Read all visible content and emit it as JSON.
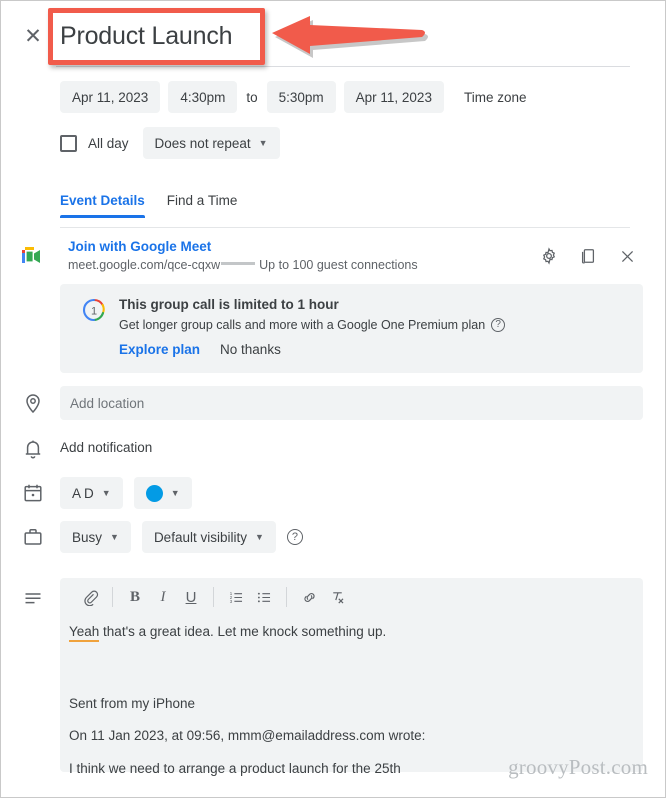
{
  "window": {
    "close_label": "✕"
  },
  "event": {
    "title": "Product Launch",
    "title_placeholder": "Add title"
  },
  "schedule": {
    "start_date": "Apr 11, 2023",
    "start_time": "4:30pm",
    "to_label": "to",
    "end_time": "5:30pm",
    "end_date": "Apr 11, 2023",
    "timezone_label": "Time zone",
    "all_day_label": "All day",
    "repeat_value": "Does not repeat"
  },
  "tabs": [
    {
      "label": "Event Details",
      "active": true
    },
    {
      "label": "Find a Time",
      "active": false
    }
  ],
  "meet": {
    "link_label": "Join with Google Meet",
    "url": "meet.google.com/qce-cqxw",
    "capacity": "Up to 100 guest connections",
    "actions": [
      {
        "name": "meet-settings",
        "icon": "gear-icon"
      },
      {
        "name": "meet-copy-link",
        "icon": "copy-icon"
      },
      {
        "name": "meet-remove",
        "icon": "close-icon"
      }
    ]
  },
  "google_one_banner": {
    "title": "This group call is limited to 1 hour",
    "subtitle": "Get longer group calls and more with a Google One Premium plan",
    "explore_label": "Explore plan",
    "dismiss_label": "No thanks",
    "help_glyph": "?"
  },
  "location": {
    "placeholder": "Add location"
  },
  "notification": {
    "label": "Add notification"
  },
  "calendar": {
    "owner_initials": "A D",
    "color_hex": "#039be5"
  },
  "availability": {
    "busy_label": "Busy",
    "visibility_label": "Default visibility",
    "help_glyph": "?"
  },
  "description": {
    "toolbar": [
      {
        "name": "attach-icon",
        "glyph": "attach"
      },
      {
        "name": "bold-icon",
        "glyph": "B"
      },
      {
        "name": "italic-icon",
        "glyph": "I"
      },
      {
        "name": "underline-icon",
        "glyph": "U"
      },
      {
        "name": "numbered-list-icon",
        "glyph": "ol"
      },
      {
        "name": "bulleted-list-icon",
        "glyph": "ul"
      },
      {
        "name": "insert-link-icon",
        "glyph": "link"
      },
      {
        "name": "clear-formatting-icon",
        "glyph": "clear"
      }
    ],
    "line1_misspelled": "Yeah",
    "line1_rest": " that's a great idea. Let me knock something up.",
    "line2": "Sent from my iPhone",
    "line3": "On 11 Jan 2023, at 09:56, mmm@emailaddress.com wrote:",
    "line4": "I think we need to arrange a product launch for the 25th"
  },
  "watermark": {
    "text": "groovyPost.com"
  },
  "annotation": {
    "highlight_color": "#f15b4b",
    "arrow_direction": "left"
  }
}
